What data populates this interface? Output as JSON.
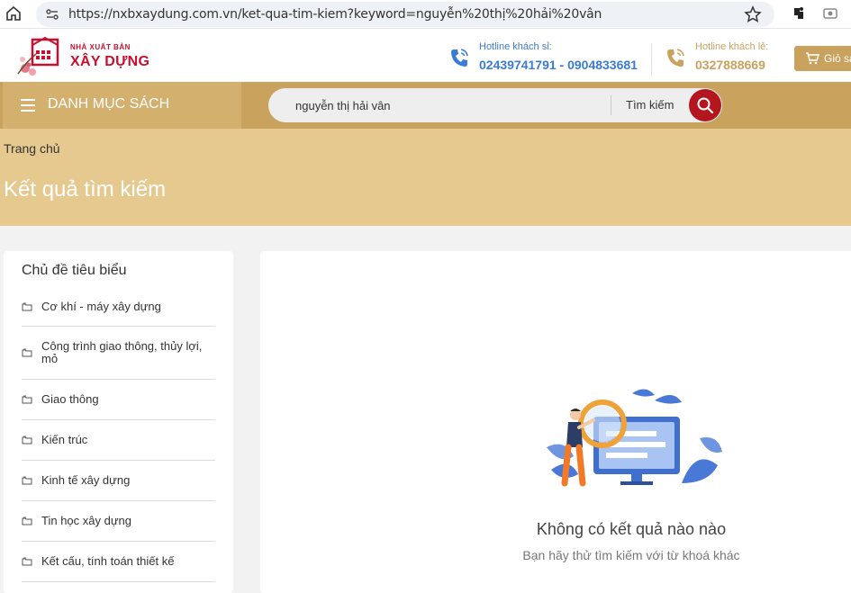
{
  "browser": {
    "url": "https://nxbxaydung.com.vn/ket-qua-tim-kiem?keyword=nguyễn%20thị%20hải%20vân"
  },
  "header": {
    "logo_small": "NHÀ XUẤT BẢN",
    "logo_big": "XÂY DỰNG",
    "hotline_wholesale_label": "Hotline khách sỉ:",
    "hotline_wholesale_value": "02439741791 - 0904833681",
    "hotline_retail_label": "Hotline khách lẻ:",
    "hotline_retail_value": "0327888669",
    "cart_label": "Giỏ sách"
  },
  "nav": {
    "menu_label": "DANH MỤC SÁCH",
    "search_value": "nguyễn thị hải vân",
    "search_type": "Tìm kiếm"
  },
  "banner": {
    "breadcrumb": "Trang chủ",
    "title": "Kết quả tìm kiếm"
  },
  "sidebar": {
    "title": "Chủ đề tiêu biểu",
    "items": [
      {
        "label": "Cơ khí - máy xây dựng"
      },
      {
        "label": "Công trình giao thông, thủy lợi, mỏ"
      },
      {
        "label": "Giao thông"
      },
      {
        "label": "Kiến trúc"
      },
      {
        "label": "Kinh tế xây dựng"
      },
      {
        "label": "Tin học xây dựng"
      },
      {
        "label": "Kết cấu, tính toán thiết kế"
      }
    ]
  },
  "main": {
    "empty_title": "Không có kết quả nào nào",
    "empty_subtitle": "Bạn hãy thử tìm kiếm với từ khoá khác"
  },
  "colors": {
    "gold": "#c9a25e",
    "banner": "#e6c98f",
    "red": "#b3161f",
    "blue": "#3a7bd5"
  }
}
